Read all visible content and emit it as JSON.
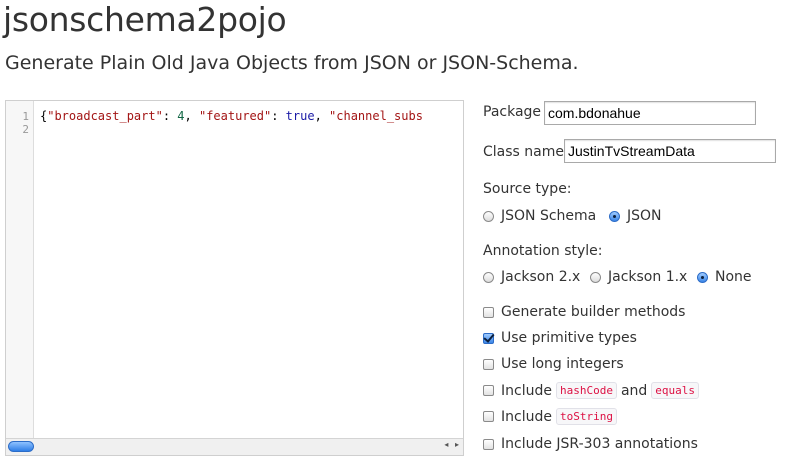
{
  "header": {
    "title": "jsonschema2pojo",
    "subtitle": "Generate Plain Old Java Objects from JSON or JSON-Schema."
  },
  "editor": {
    "line_numbers": [
      "1",
      "2"
    ],
    "tokens": [
      {
        "cls": "c-punct",
        "text": "{"
      },
      {
        "cls": "c-str",
        "text": "\"broadcast_part\""
      },
      {
        "cls": "c-punct",
        "text": ": "
      },
      {
        "cls": "c-num",
        "text": "4"
      },
      {
        "cls": "c-punct",
        "text": ", "
      },
      {
        "cls": "c-str",
        "text": "\"featured\""
      },
      {
        "cls": "c-punct",
        "text": ": "
      },
      {
        "cls": "c-kw",
        "text": "true"
      },
      {
        "cls": "c-punct",
        "text": ", "
      },
      {
        "cls": "c-str",
        "text": "\"channel_subs"
      }
    ],
    "scroll_arrows": "◂ ▸"
  },
  "form": {
    "package_label": "Package",
    "package_value": "com.bdonahue",
    "classname_label": "Class name",
    "classname_value": "JustinTvStreamData",
    "source_type_label": "Source type:",
    "source_types": [
      {
        "label": "JSON Schema",
        "selected": false
      },
      {
        "label": "JSON",
        "selected": true
      }
    ],
    "annotation_label": "Annotation style:",
    "annotations": [
      {
        "label": "Jackson 2.x",
        "selected": false
      },
      {
        "label": "Jackson 1.x",
        "selected": false
      },
      {
        "label": "None",
        "selected": true
      }
    ],
    "opt_builder": "Generate builder methods",
    "opt_primitive": "Use primitive types",
    "opt_long": "Use long integers",
    "opt_include": "Include",
    "opt_hashcode": "hashCode",
    "opt_and": "and",
    "opt_equals": "equals",
    "opt_tostring": "toString",
    "opt_jsr": "Include JSR-303 annotations"
  }
}
